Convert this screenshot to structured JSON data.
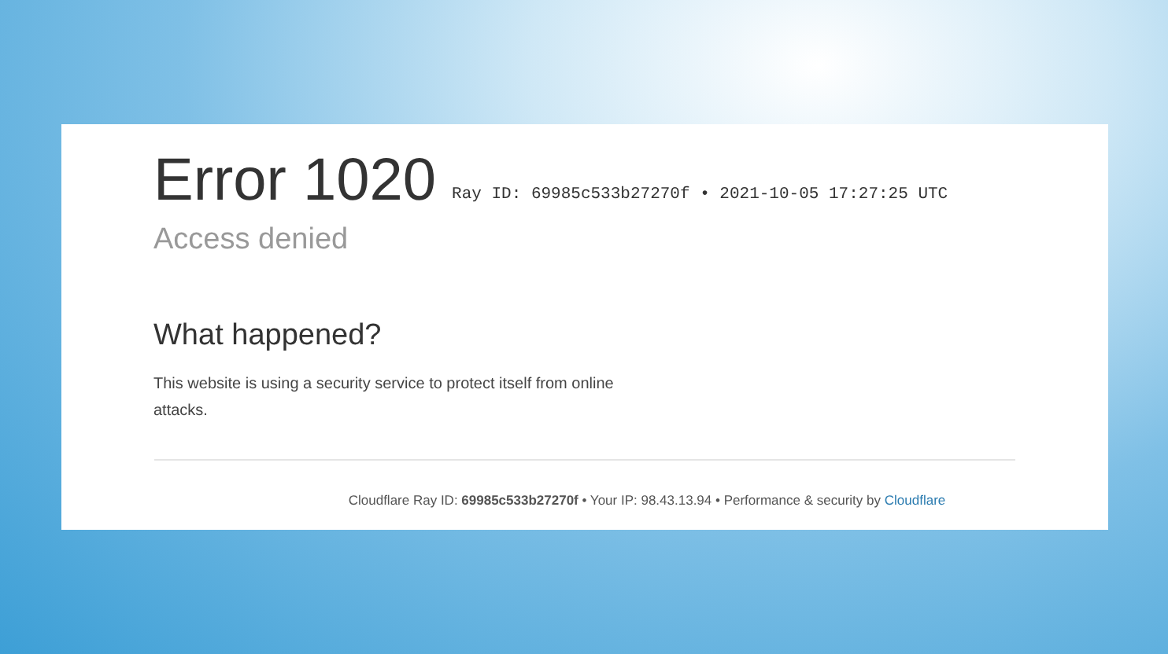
{
  "error": {
    "title": "Error 1020",
    "meta": "Ray ID: 69985c533b27270f • 2021-10-05 17:27:25 UTC",
    "subtitle": "Access denied"
  },
  "section": {
    "heading": "What happened?",
    "body": "This website is using a security service to protect itself from online attacks."
  },
  "footer": {
    "text": "Cloudflare Ray ID: **69985c533b27270f** • Your IP: 98.43.13.94 • Performance & security by",
    "link": "Cloudflare"
  }
}
